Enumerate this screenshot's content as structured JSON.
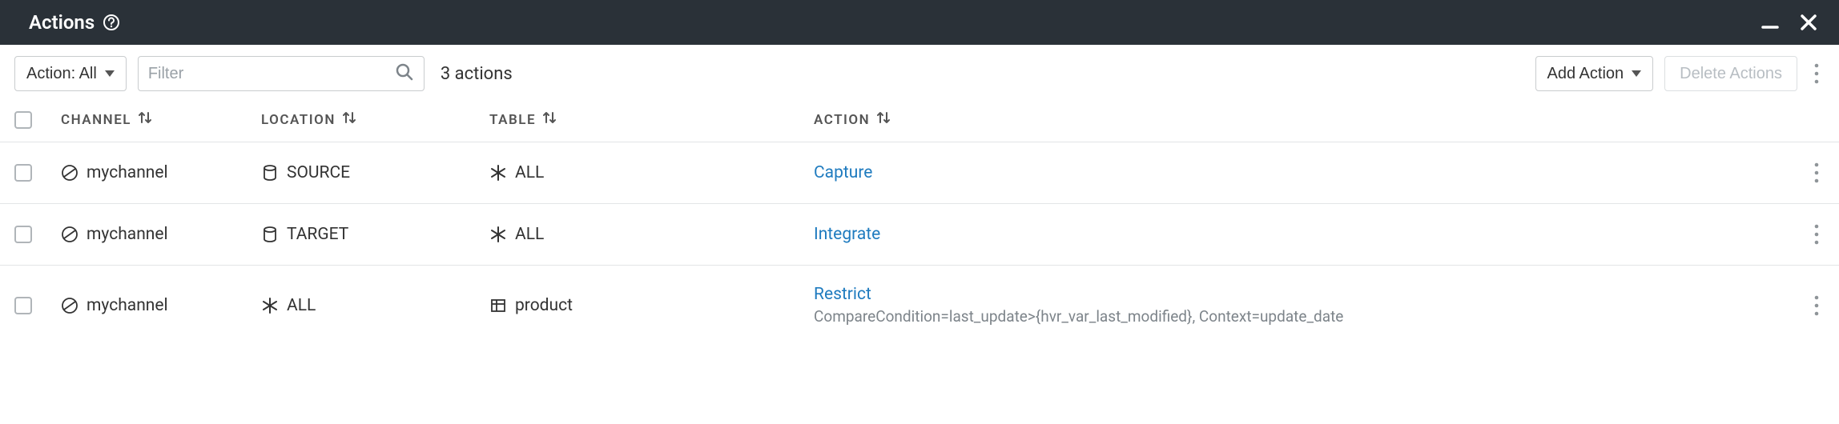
{
  "header": {
    "title": "Actions"
  },
  "toolbar": {
    "filter_dropdown_label": "Action: All",
    "filter_placeholder": "Filter",
    "count_text": "3 actions",
    "add_action_label": "Add Action",
    "delete_actions_label": "Delete Actions"
  },
  "columns": {
    "channel": "CHANNEL",
    "location": "LOCATION",
    "table": "TABLE",
    "action": "ACTION"
  },
  "rows": [
    {
      "channel": "mychannel",
      "location": "SOURCE",
      "location_icon": "database",
      "table": "ALL",
      "table_icon": "asterisk",
      "action": "Capture",
      "detail": ""
    },
    {
      "channel": "mychannel",
      "location": "TARGET",
      "location_icon": "database",
      "table": "ALL",
      "table_icon": "asterisk",
      "action": "Integrate",
      "detail": ""
    },
    {
      "channel": "mychannel",
      "location": "ALL",
      "location_icon": "asterisk",
      "table": "product",
      "table_icon": "table",
      "action": "Restrict",
      "detail": "CompareCondition=last_update>{hvr_var_last_modified}, Context=update_date"
    }
  ]
}
